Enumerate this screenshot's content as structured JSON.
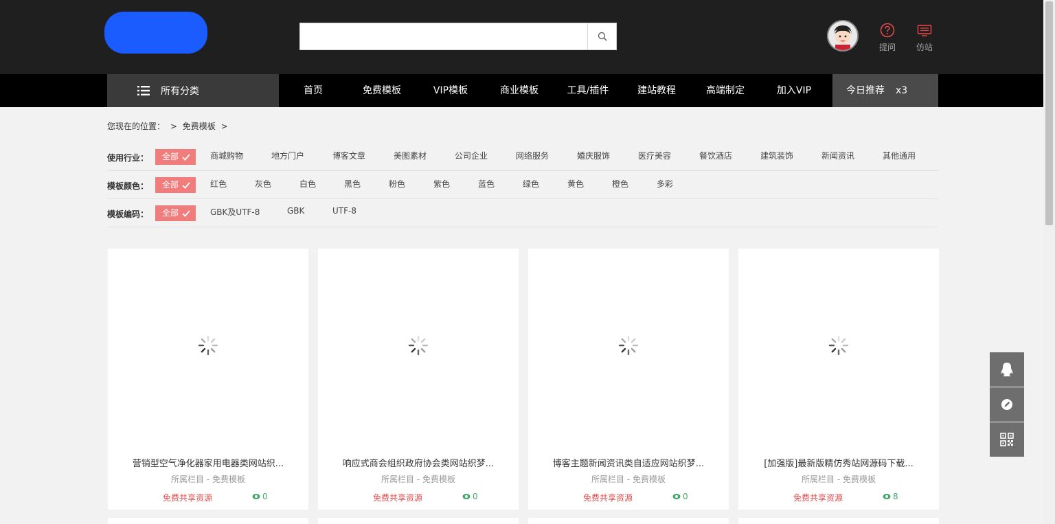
{
  "header": {
    "search": {
      "placeholder": "",
      "value": ""
    },
    "links": [
      {
        "label": "提问",
        "icon": "question-circle-icon"
      },
      {
        "label": "仿站",
        "icon": "monitor-icon"
      }
    ]
  },
  "nav": {
    "all_categories": "所有分类",
    "items": [
      "首页",
      "免费模板",
      "VIP模板",
      "商业模板",
      "工具/插件",
      "建站教程",
      "高端制定",
      "加入VIP"
    ],
    "today_label": "今日推荐",
    "today_count": "x3"
  },
  "breadcrumb": {
    "prefix": "您现在的位置：",
    "sep": ">",
    "current": "免费模板"
  },
  "filters": [
    {
      "label": "使用行业：",
      "all": "全部",
      "options": [
        "商城购物",
        "地方门户",
        "博客文章",
        "美图素材",
        "公司企业",
        "网络服务",
        "婚庆服饰",
        "医疗美容",
        "餐饮酒店",
        "建筑装饰",
        "新闻资讯",
        "其他通用"
      ]
    },
    {
      "label": "模板颜色：",
      "all": "全部",
      "options": [
        "红色",
        "灰色",
        "白色",
        "黑色",
        "粉色",
        "紫色",
        "蓝色",
        "绿色",
        "黄色",
        "橙色",
        "多彩"
      ]
    },
    {
      "label": "模板编码：",
      "all": "全部",
      "options": [
        "GBK及UTF-8",
        "GBK",
        "UTF-8"
      ]
    }
  ],
  "cards": [
    {
      "title": "营销型空气净化器家用电器类网站织...",
      "category": "所属栏目 - 免费模板",
      "tag": "免费共享资源",
      "views": "0"
    },
    {
      "title": "响应式商会组织政府协会类网站织梦...",
      "category": "所属栏目 - 免费模板",
      "tag": "免费共享资源",
      "views": "0"
    },
    {
      "title": "博客主题新闻资讯类自适应网站织梦...",
      "category": "所属栏目 - 免费模板",
      "tag": "免费共享资源",
      "views": "0"
    },
    {
      "title": "[加强版]最新版精仿秀站网源码下载...",
      "category": "所属栏目 - 免费模板",
      "tag": "免费共享资源",
      "views": "8"
    }
  ],
  "side_tools": [
    "qq-icon",
    "edit-icon",
    "qrcode-icon"
  ],
  "colors": {
    "brand": "#1a5cff",
    "accent": "#f17c7c",
    "header_bg": "#1f1f1f",
    "nav_bg": "#000000"
  }
}
